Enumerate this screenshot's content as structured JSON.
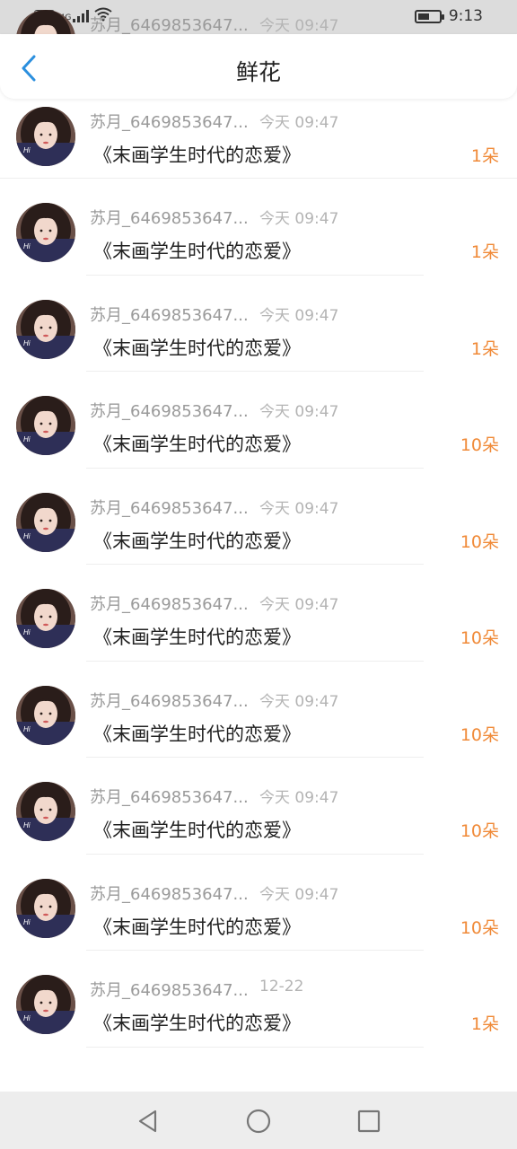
{
  "status_bar": {
    "hd": "HD",
    "network": "4G",
    "time": "9:13",
    "battery_level": 0.55,
    "icons": [
      "hd-icon",
      "signal-icon",
      "wifi-icon",
      "battery-icon"
    ]
  },
  "header": {
    "title": "鲜花",
    "back_icon": "chevron-left-icon",
    "accent_color": "#2b8fde"
  },
  "colors": {
    "count": "#f08a38",
    "name": "#9a9a9a",
    "time": "#b4b4b4"
  },
  "items": [
    {
      "name": "苏月_6469853647...",
      "time": "今天 09:47",
      "title": "《末画学生时代的恋爱》",
      "count": "1朵"
    },
    {
      "name": "苏月_6469853647...",
      "time": "今天 09:47",
      "title": "《末画学生时代的恋爱》",
      "count": "1朵"
    },
    {
      "name": "苏月_6469853647...",
      "time": "今天 09:47",
      "title": "《末画学生时代的恋爱》",
      "count": "1朵"
    },
    {
      "name": "苏月_6469853647...",
      "time": "今天 09:47",
      "title": "《末画学生时代的恋爱》",
      "count": "1朵"
    },
    {
      "name": "苏月_6469853647...",
      "time": "今天 09:47",
      "title": "《末画学生时代的恋爱》",
      "count": "10朵"
    },
    {
      "name": "苏月_6469853647...",
      "time": "今天 09:47",
      "title": "《末画学生时代的恋爱》",
      "count": "10朵"
    },
    {
      "name": "苏月_6469853647...",
      "time": "今天 09:47",
      "title": "《末画学生时代的恋爱》",
      "count": "10朵"
    },
    {
      "name": "苏月_6469853647...",
      "time": "今天 09:47",
      "title": "《末画学生时代的恋爱》",
      "count": "10朵"
    },
    {
      "name": "苏月_6469853647...",
      "time": "今天 09:47",
      "title": "《末画学生时代的恋爱》",
      "count": "10朵"
    },
    {
      "name": "苏月_6469853647...",
      "time": "今天 09:47",
      "title": "《末画学生时代的恋爱》",
      "count": "10朵"
    },
    {
      "name": "苏月_6469853647...",
      "time": "12-22",
      "title": "《末画学生时代的恋爱》",
      "count": "1朵"
    }
  ],
  "nav_bar": {
    "icons": [
      "back-triangle-icon",
      "home-circle-icon",
      "recents-square-icon"
    ]
  }
}
